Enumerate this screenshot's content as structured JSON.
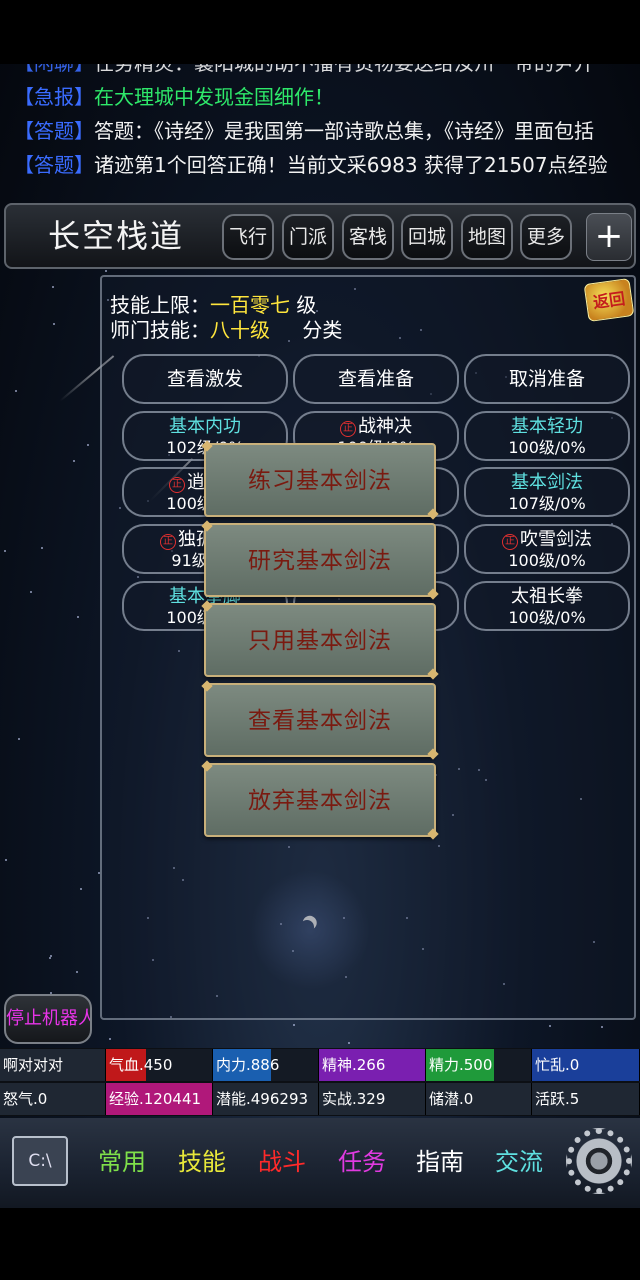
{
  "chat": [
    {
      "tag": "【闲聊】",
      "text": "任务精灵：襄阳城的胡不播有货物要送给汝州一带的尹开",
      "color": "#f2f2f2"
    },
    {
      "tag": "【急报】",
      "text": "在大理城中发现金国细作！",
      "color": "#2ee86a"
    },
    {
      "tag": "【答题】",
      "text": "答题：《诗经》是我国第一部诗歌总集，《诗经》里面包括",
      "color": "#f2f2f2"
    },
    {
      "tag": "【答题】",
      "text": "诸迹第1个回答正确！当前文采6983 获得了21507点经验",
      "color": "#f2f2f2"
    }
  ],
  "location": {
    "title": "长空栈道",
    "buttons": [
      "飞行",
      "门派",
      "客栈",
      "回城",
      "地图",
      "更多"
    ],
    "plus": "+"
  },
  "skills_panel": {
    "limit_label": "技能上限：",
    "limit_value": "一百零七",
    "limit_unit": " 级",
    "master_label": "师门技能：",
    "master_value": "八十级",
    "category": "分类",
    "back_label": "返回",
    "actions": [
      "查看激发",
      "查看准备",
      "取消准备"
    ],
    "skills": [
      {
        "name": "基本内功",
        "level": "102级/0%",
        "color": "cyan",
        "mark": false
      },
      {
        "name": "战神决",
        "level": "100级/0%",
        "color": "white",
        "mark": true
      },
      {
        "name": "基本轻功",
        "level": "100级/0%",
        "color": "cyan",
        "mark": false
      },
      {
        "name": "逍遥游",
        "level": "100级/0%",
        "color": "white",
        "mark": true
      },
      {
        "name": "",
        "level": "",
        "color": "white",
        "mark": false
      },
      {
        "name": "基本剑法",
        "level": "107级/0%",
        "color": "cyan",
        "mark": false
      },
      {
        "name": "独孤九剑",
        "level": "91级/0%",
        "color": "white",
        "mark": true
      },
      {
        "name": "",
        "level": "",
        "color": "white",
        "mark": false
      },
      {
        "name": "吹雪剑法",
        "level": "100级/0%",
        "color": "white",
        "mark": true
      },
      {
        "name": "基本拳脚",
        "level": "100级/0%",
        "color": "cyan",
        "mark": false
      },
      {
        "name": "",
        "level": "",
        "color": "white",
        "mark": false
      },
      {
        "name": "太祖长拳",
        "level": "100级/0%",
        "color": "white",
        "mark": false
      }
    ]
  },
  "popup_menu": [
    "练习基本剑法",
    "研究基本剑法",
    "只用基本剑法",
    "查看基本剑法",
    "放弃基本剑法"
  ],
  "stop_robot": "停止机器人",
  "stats": {
    "row1": [
      {
        "label": "啊对对对",
        "color": "#1f2733",
        "fill": 1.0
      },
      {
        "label": "气血.450",
        "color": "#c0181a",
        "fill": 0.38
      },
      {
        "label": "内力.886",
        "color": "#1a5fb0",
        "fill": 0.55
      },
      {
        "label": "精神.266",
        "color": "#7a1fb0",
        "fill": 1.0
      },
      {
        "label": "精力.500",
        "color": "#1f9a3a",
        "fill": 0.65
      },
      {
        "label": "忙乱.0",
        "color": "#1a3f9a",
        "fill": 1.0
      }
    ],
    "row2": [
      {
        "label": "怒气.0",
        "color": "#1f2733",
        "fill": 1.0
      },
      {
        "label": "经验.120441",
        "color": "#b0187a",
        "fill": 1.0
      },
      {
        "label": "潜能.496293",
        "color": "#1f2733",
        "fill": 1.0
      },
      {
        "label": "实战.329",
        "color": "#1f2733",
        "fill": 1.0
      },
      {
        "label": "储潜.0",
        "color": "#1f2733",
        "fill": 1.0
      },
      {
        "label": "活跃.5",
        "color": "#1f2733",
        "fill": 1.0
      }
    ]
  },
  "bottom_nav": [
    {
      "label": "常用",
      "color": "#7fe04a"
    },
    {
      "label": "技能",
      "color": "#e8e83a"
    },
    {
      "label": "战斗",
      "color": "#ff2a2a"
    },
    {
      "label": "任务",
      "color": "#e03ae0"
    },
    {
      "label": "指南",
      "color": "#ffffff"
    },
    {
      "label": "交流",
      "color": "#5fe0e0"
    }
  ],
  "cmd_icon_label": "C:\\"
}
